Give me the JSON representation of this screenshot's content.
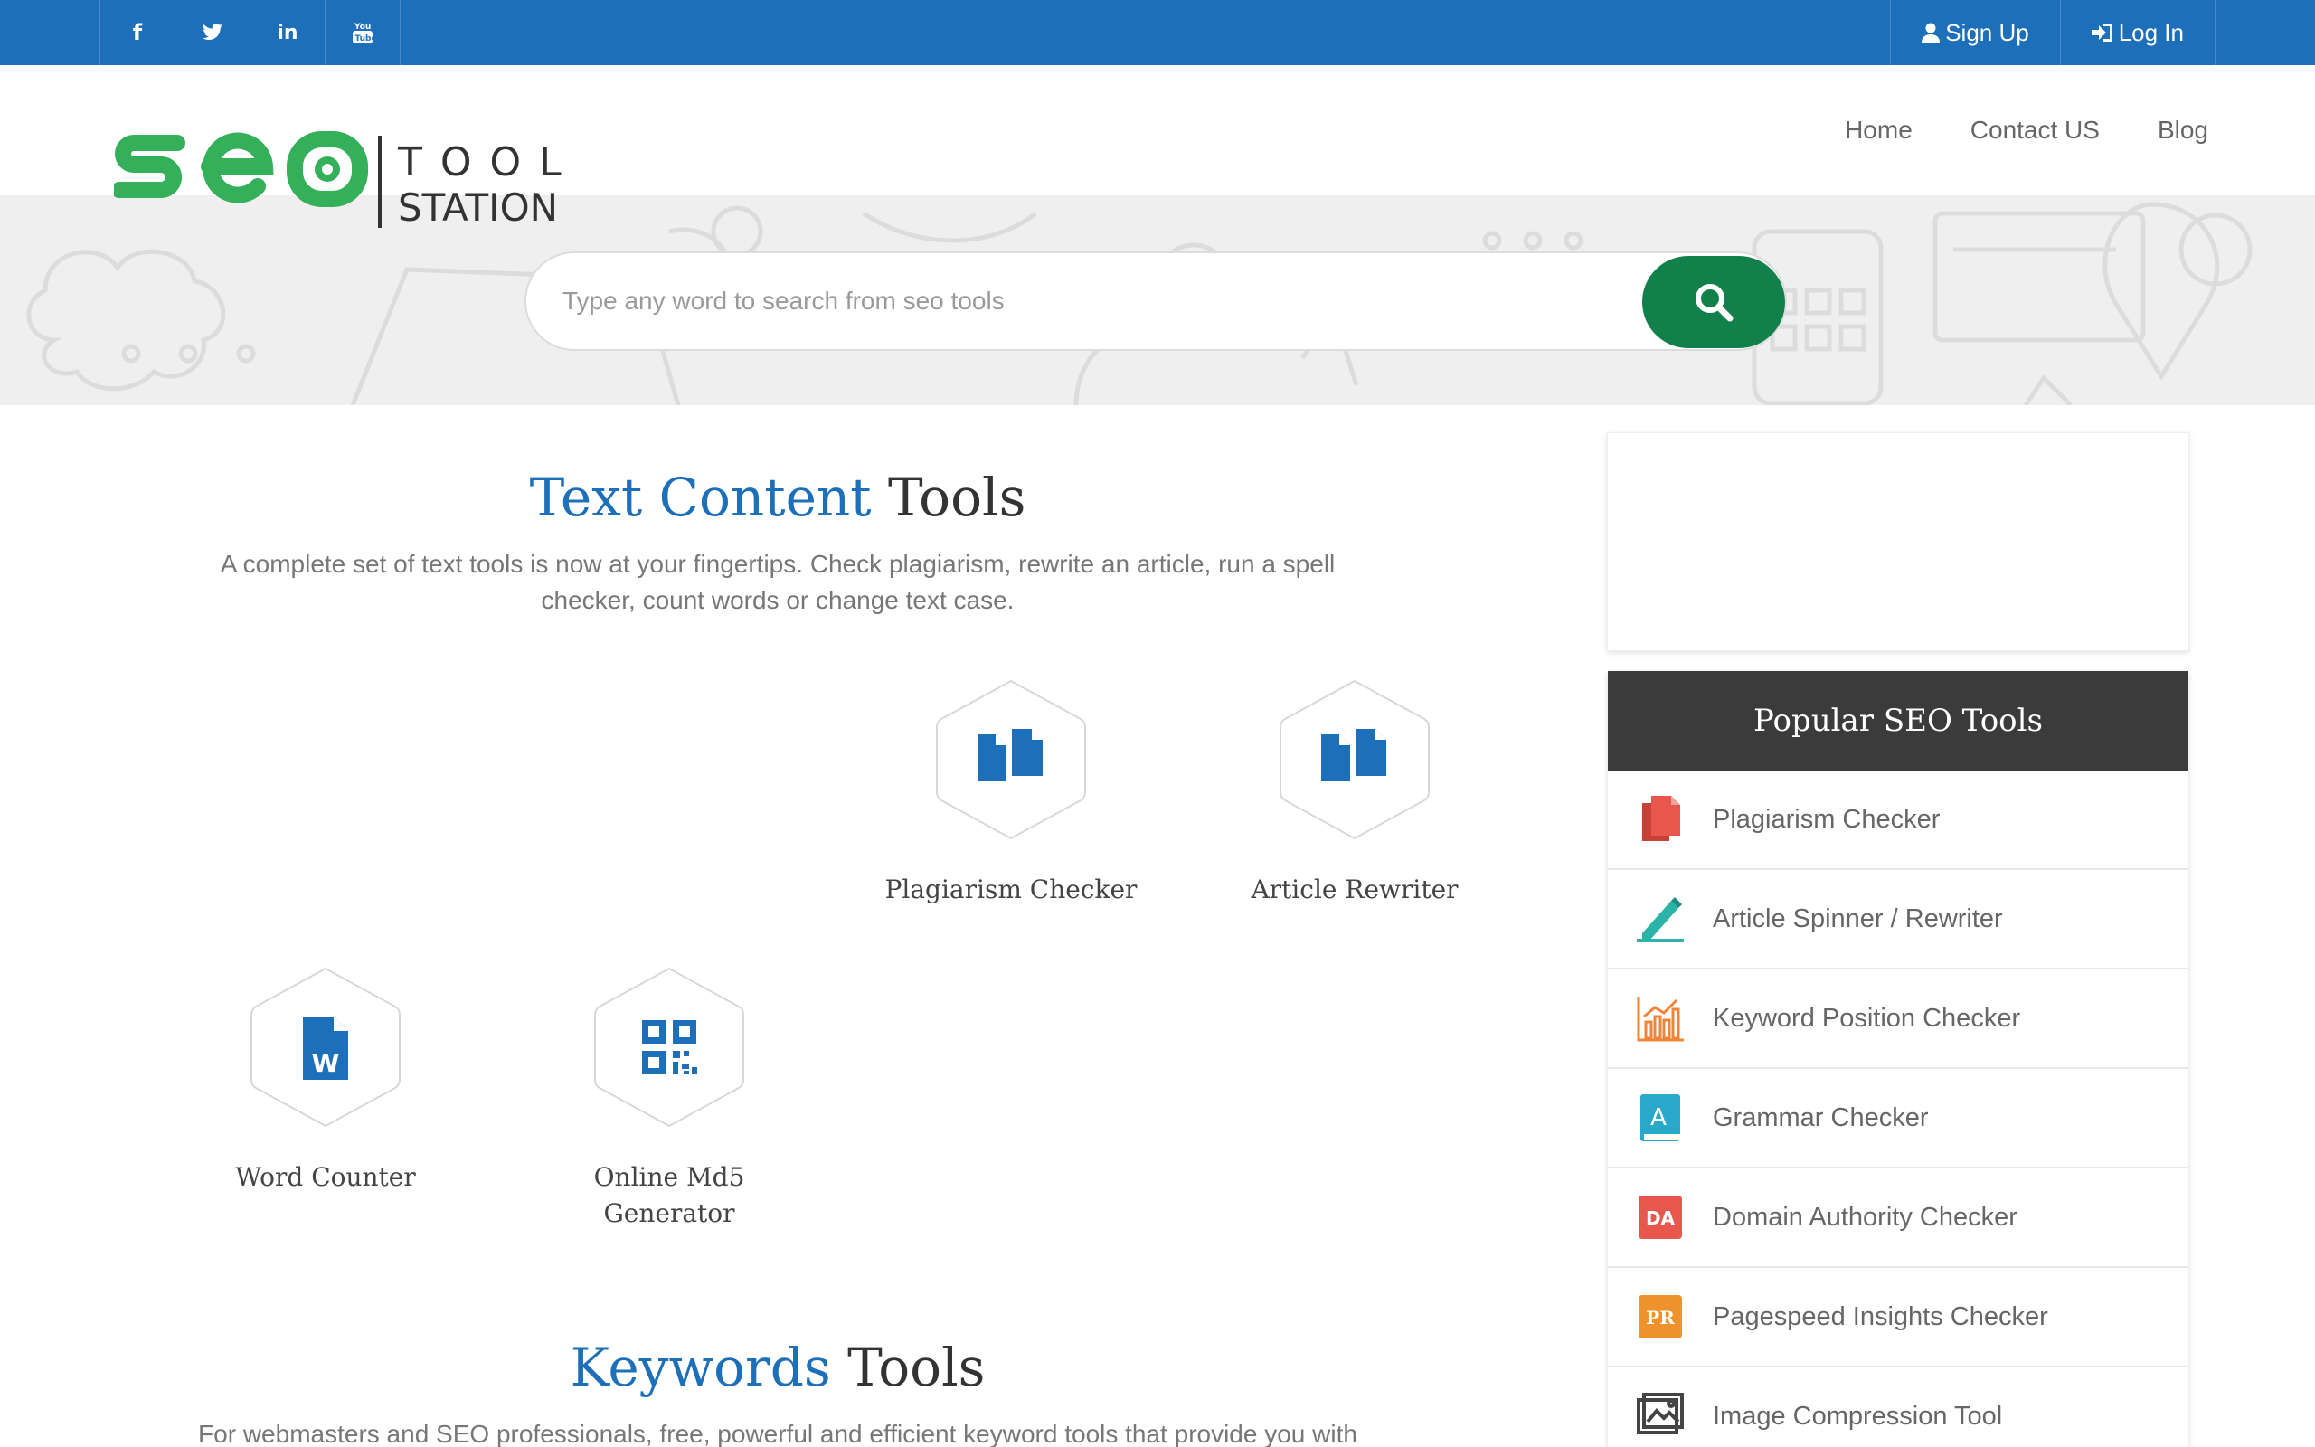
{
  "topbar": {
    "social": [
      {
        "icon": "facebook-icon",
        "glyph": "f"
      },
      {
        "icon": "twitter-icon",
        "glyph": "t"
      },
      {
        "icon": "linkedin-icon",
        "glyph": "in"
      },
      {
        "icon": "youtube-icon",
        "glyph": "You"
      }
    ],
    "signup_label": "Sign Up",
    "login_label": "Log In"
  },
  "logo": {
    "seo": "seo",
    "tool": "TOOL",
    "station": "STATION"
  },
  "nav": {
    "home": "Home",
    "contact": "Contact US",
    "blog": "Blog"
  },
  "search": {
    "placeholder": "Type any word to search from seo tools",
    "button_icon": "search-icon"
  },
  "text_tools": {
    "title_accent": "Text Content",
    "title_rest": "Tools",
    "description": "A complete set of text tools is now at your fingertips. Check plagiarism, rewrite an article, run a spell checker, count words or change text case.",
    "tools": [
      {
        "label": "Plagiarism Checker",
        "icon": "documents-icon"
      },
      {
        "label": "Article Rewriter",
        "icon": "documents-icon"
      },
      {
        "label": "Word Counter",
        "icon": "word-document-icon"
      },
      {
        "label": "Online Md5 Generator",
        "icon": "qr-code-icon"
      }
    ]
  },
  "keyword_tools": {
    "title_accent": "Keywords",
    "title_rest": "Tools",
    "description": "For webmasters and SEO professionals, free, powerful and efficient keyword tools that provide you with"
  },
  "sidebar": {
    "popular_title": "Popular SEO Tools",
    "items": [
      {
        "label": "Plagiarism Checker",
        "icon": "plagiarism-icon",
        "color": "#e8574e"
      },
      {
        "label": "Article Spinner / Rewriter",
        "icon": "pencil-icon",
        "color": "#2ab3a6"
      },
      {
        "label": "Keyword Position Checker",
        "icon": "bar-chart-icon",
        "color": "#f0853a"
      },
      {
        "label": "Grammar Checker",
        "icon": "grammar-book-icon",
        "color": "#29a9c9",
        "badge": "A"
      },
      {
        "label": "Domain Authority Checker",
        "icon": "domain-authority-icon",
        "color": "#e8574e",
        "badge": "DA"
      },
      {
        "label": "Pagespeed Insights Checker",
        "icon": "pagespeed-icon",
        "color": "#f0922b",
        "badge": "PR"
      },
      {
        "label": "Image Compression Tool",
        "icon": "image-compression-icon",
        "color": "#555555"
      }
    ]
  },
  "colors": {
    "topbar": "#1e6fba",
    "accent": "#1e6fba",
    "search_button": "#11804a",
    "logo_green": "#35b05a",
    "popular_header": "#3b3b3b"
  }
}
